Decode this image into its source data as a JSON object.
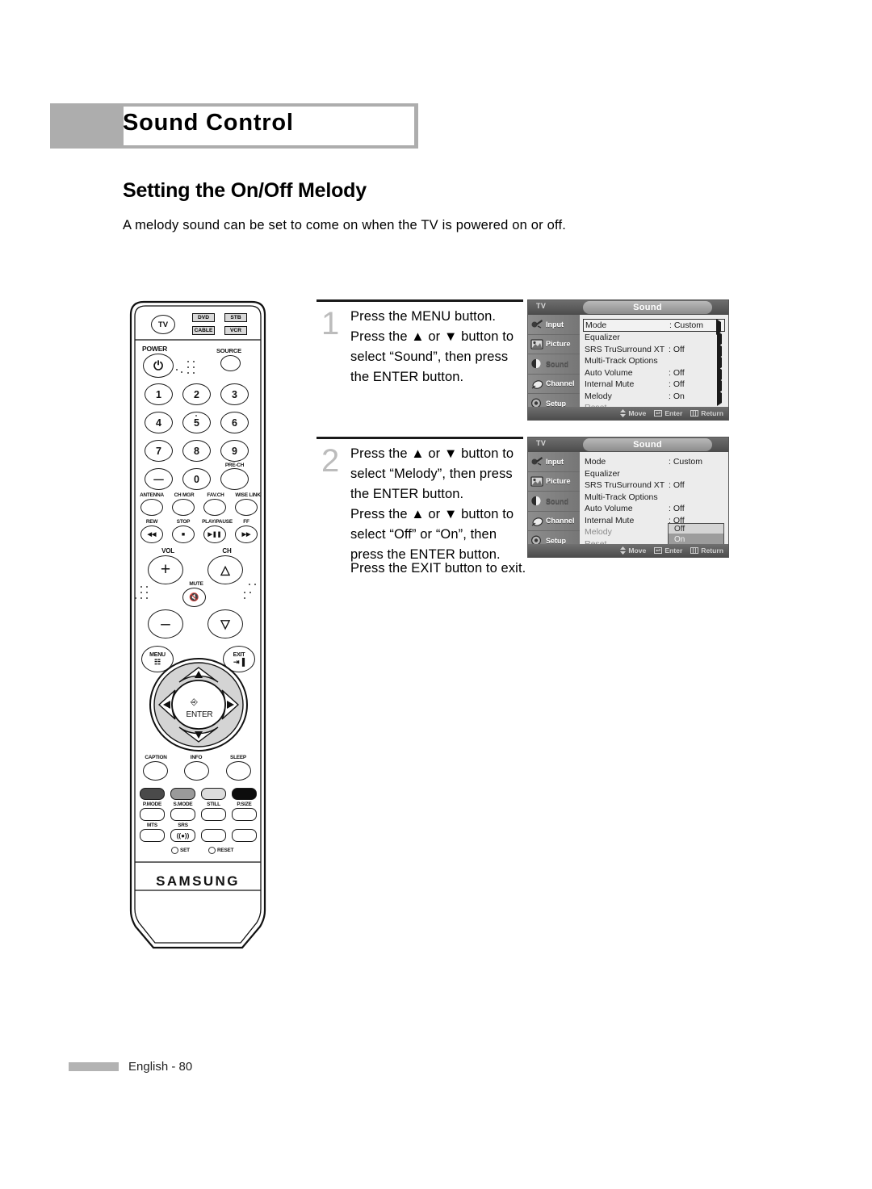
{
  "header": {
    "chapter": "Sound Control",
    "section": "Setting the On/Off Melody",
    "intro": "A melody sound can be set to come on when the TV is powered on or off."
  },
  "footer": {
    "page_label": "English - 80"
  },
  "steps": [
    {
      "number": "1",
      "lines": [
        "Press the MENU button.",
        "Press the ▲ or ▼ button to",
        "select “Sound”, then press",
        "the ENTER button."
      ]
    },
    {
      "number": "2",
      "lines": [
        "Press the ▲ or ▼ button to",
        "select “Melody”, then press",
        "the ENTER button.",
        "Press the ▲ or ▼ button to",
        "select “Off” or “On”, then",
        "press the ENTER button."
      ]
    }
  ],
  "exit_note": "Press the EXIT button to exit.",
  "osd": {
    "source_label": "TV",
    "title": "Sound",
    "sidebar": [
      {
        "label": "Input",
        "icon": "input-icon",
        "active": false
      },
      {
        "label": "Picture",
        "icon": "picture-icon",
        "active": false
      },
      {
        "label": "Sound",
        "icon": "sound-icon",
        "active": true
      },
      {
        "label": "Channel",
        "icon": "channel-icon",
        "active": false
      },
      {
        "label": "Setup",
        "icon": "setup-icon",
        "active": false
      }
    ],
    "footer_hints": [
      {
        "icon": "updown-icon",
        "label": "Move"
      },
      {
        "icon": "enter-icon",
        "label": "Enter"
      },
      {
        "icon": "return-icon",
        "label": "Return"
      }
    ],
    "screen1": {
      "rows": [
        {
          "name": "Mode",
          "value": ": Custom",
          "arrow": true,
          "highlight": true,
          "dim": false
        },
        {
          "name": "Equalizer",
          "value": "",
          "arrow": true,
          "highlight": false,
          "dim": false
        },
        {
          "name": "SRS TruSurround XT",
          "value": ": Off",
          "arrow": true,
          "highlight": false,
          "dim": false
        },
        {
          "name": "Multi-Track Options",
          "value": "",
          "arrow": true,
          "highlight": false,
          "dim": false
        },
        {
          "name": "Auto Volume",
          "value": ": Off",
          "arrow": true,
          "highlight": false,
          "dim": false
        },
        {
          "name": "Internal Mute",
          "value": ": Off",
          "arrow": true,
          "highlight": false,
          "dim": false
        },
        {
          "name": "Melody",
          "value": ": On",
          "arrow": true,
          "highlight": false,
          "dim": false
        },
        {
          "name": "Reset",
          "value": "",
          "arrow": false,
          "highlight": false,
          "dim": true
        }
      ]
    },
    "screen2": {
      "rows": [
        {
          "name": "Mode",
          "value": ": Custom",
          "arrow": false,
          "highlight": false,
          "dim": false
        },
        {
          "name": "Equalizer",
          "value": "",
          "arrow": false,
          "highlight": false,
          "dim": false
        },
        {
          "name": "SRS TruSurround XT",
          "value": ": Off",
          "arrow": false,
          "highlight": false,
          "dim": false
        },
        {
          "name": "Multi-Track Options",
          "value": "",
          "arrow": false,
          "highlight": false,
          "dim": false
        },
        {
          "name": "Auto Volume",
          "value": ": Off",
          "arrow": false,
          "highlight": false,
          "dim": false
        },
        {
          "name": "Internal Mute",
          "value": ": Off",
          "arrow": false,
          "highlight": false,
          "dim": false
        },
        {
          "name": "Melody",
          "value": "",
          "arrow": false,
          "highlight": false,
          "dim": true
        },
        {
          "name": "Reset",
          "value": "",
          "arrow": false,
          "highlight": false,
          "dim": true
        }
      ],
      "popup": {
        "options": [
          {
            "label": "Off",
            "selected": false
          },
          {
            "label": "On",
            "selected": true
          }
        ]
      }
    }
  },
  "remote": {
    "brand": "SAMSUNG",
    "mode_buttons": [
      {
        "label": "TV",
        "shape": "round"
      },
      {
        "label": "DVD",
        "shape": "box"
      },
      {
        "label": "STB",
        "shape": "box"
      },
      {
        "label": "CABLE",
        "shape": "box"
      },
      {
        "label": "VCR",
        "shape": "box"
      }
    ],
    "power_label": "POWER",
    "source_label": "SOURCE",
    "numpad": [
      "1",
      "2",
      "3",
      "4",
      "5",
      "6",
      "7",
      "8",
      "9",
      "—",
      "0",
      ""
    ],
    "pre_ch_label": "PRE-CH",
    "function_row": [
      "ANTENNA",
      "CH MGR",
      "FAV.CH",
      "WISE LINK"
    ],
    "transport_row": [
      {
        "label": "REW",
        "glyph": "◀◀"
      },
      {
        "label": "STOP",
        "glyph": "■"
      },
      {
        "label": "PLAY/PAUSE",
        "glyph": "▶❘❘"
      },
      {
        "label": "FF",
        "glyph": "▶▶"
      }
    ],
    "vol_label": "VOL",
    "ch_label": "CH",
    "mute_label": "MUTE",
    "menu_label": "MENU",
    "exit_label": "EXIT",
    "enter_label": "ENTER",
    "bottom_row1": [
      "CAPTION",
      "INFO",
      "SLEEP"
    ],
    "color_buttons": [
      "#4a4a4a",
      "#9a9a9a",
      "#dcdcdc",
      "#0d0d0d"
    ],
    "mode_row": [
      "P.MODE",
      "S.MODE",
      "STILL",
      "P.SIZE"
    ],
    "mts_row": [
      "MTS",
      "SRS"
    ],
    "set_label": "SET",
    "reset_label": "RESET"
  }
}
